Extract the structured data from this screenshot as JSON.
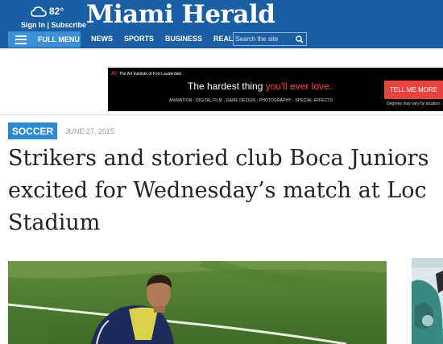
{
  "header": {
    "weather_temp": "82°",
    "weather_icon": "cloud-icon",
    "signin_text": "Sign In | Subscribe",
    "logo": "Miami Herald",
    "menu_label": "FULL MENU",
    "nav": [
      "NEWS",
      "SPORTS",
      "BUSINESS",
      "REAL ESTATE"
    ],
    "search_placeholder": "Search the site",
    "colors": {
      "bar": "#1a5fa3",
      "menu": "#3d8fd6"
    }
  },
  "ad": {
    "brand": "The Art Institute of Fort Lauderdale",
    "headline_white": "The hardest thing ",
    "headline_red": "you'll ever love.",
    "programs": "ANIMATION · DIGITAL FILM · GAME DESIGN · PHOTOGRAPHY · SPECIAL EFFECTS",
    "cta": "TELL ME MORE",
    "disclaimer": "Degrees may vary by location."
  },
  "article": {
    "section": "SOCCER",
    "date": "JUNE 27, 2015",
    "title_lines": [
      "Strikers and storied club Boca Juniors",
      "excited for Wednesday’s match at Loc",
      "Stadium"
    ],
    "tag_color": "#2c8ad0"
  }
}
